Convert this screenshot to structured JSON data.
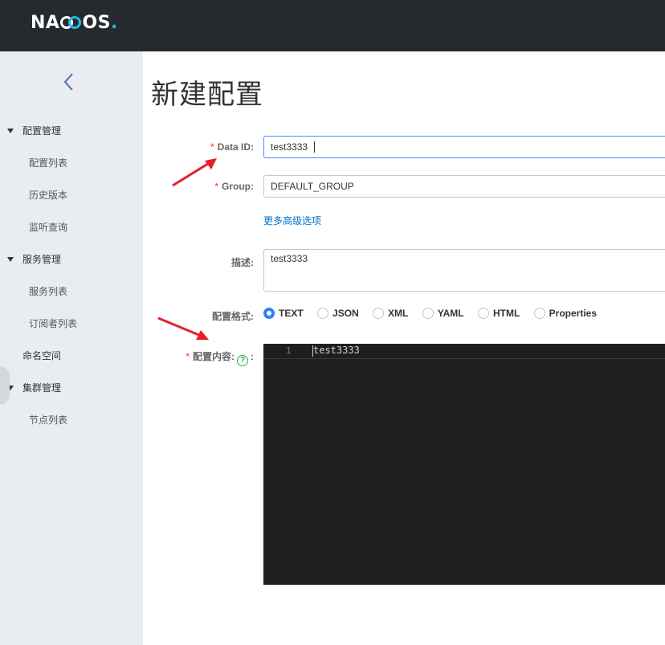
{
  "header": {
    "logo": {
      "part1": "NA",
      "part2": "OS",
      "dot": "."
    }
  },
  "sidebar": {
    "collapse_icon": "chevron-left-icon",
    "groups": [
      {
        "label": "配置管理",
        "items": [
          "配置列表",
          "历史版本",
          "监听查询"
        ]
      },
      {
        "label": "服务管理",
        "items": [
          "服务列表",
          "订阅者列表"
        ]
      },
      {
        "label": "命名空间",
        "items": []
      },
      {
        "label": "集群管理",
        "items": [
          "节点列表"
        ]
      }
    ]
  },
  "main": {
    "title": "新建配置",
    "form": {
      "required_mark": "*",
      "data_id": {
        "label": "Data ID:",
        "value": "test3333"
      },
      "group": {
        "label": "Group:",
        "value": "DEFAULT_GROUP"
      },
      "more_options": "更多高级选项",
      "description": {
        "label": "描述:",
        "value": "test3333"
      },
      "format": {
        "label": "配置格式:",
        "options": [
          "TEXT",
          "JSON",
          "XML",
          "YAML",
          "HTML",
          "Properties"
        ],
        "selected": "TEXT"
      },
      "content": {
        "label": "配置内容:",
        "help_icon": "question-circle-icon",
        "colon": ":",
        "line_number": "1",
        "code": "test3333"
      }
    }
  },
  "colors": {
    "accent": "#3080fe",
    "required": "#ff3000",
    "link": "#0070cc",
    "annotation_arrow": "#e6202a",
    "header_bg": "#252a2f",
    "sidebar_bg": "#e9edf1",
    "editor_bg": "#1e1e1e"
  }
}
